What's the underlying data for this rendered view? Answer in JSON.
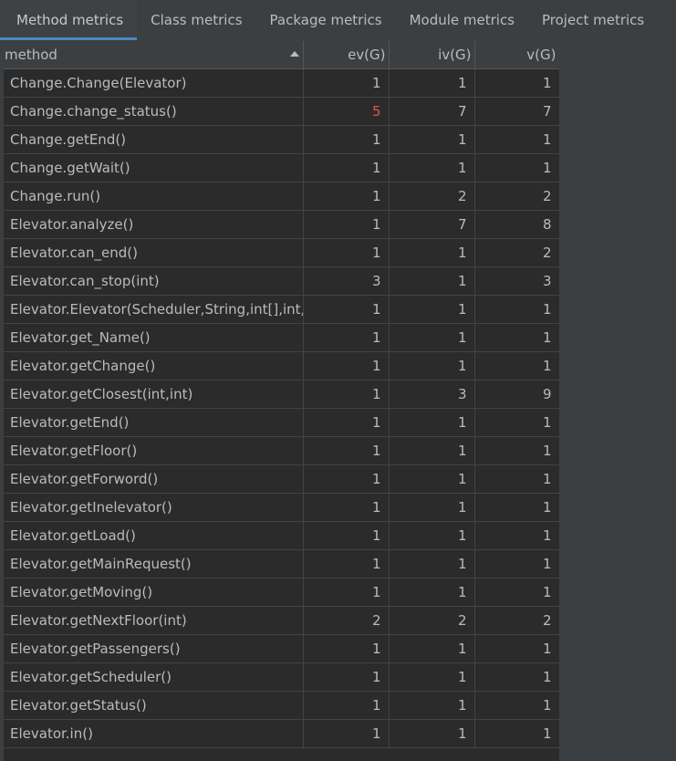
{
  "tabs": [
    {
      "label": "Method metrics",
      "active": true
    },
    {
      "label": "Class metrics",
      "active": false
    },
    {
      "label": "Package metrics",
      "active": false
    },
    {
      "label": "Module metrics",
      "active": false
    },
    {
      "label": "Project metrics",
      "active": false
    }
  ],
  "table": {
    "headers": [
      "method",
      "ev(G)",
      "iv(G)",
      "v(G)"
    ],
    "sorted_column": "method",
    "sort_direction": "ascending",
    "highlight_color": "#e05555",
    "rows": [
      {
        "method": "Change.Change(Elevator)",
        "ev": "1",
        "iv": "1",
        "v": "1"
      },
      {
        "method": "Change.change_status()",
        "ev": "5",
        "iv": "7",
        "v": "7",
        "ev_warn": true
      },
      {
        "method": "Change.getEnd()",
        "ev": "1",
        "iv": "1",
        "v": "1"
      },
      {
        "method": "Change.getWait()",
        "ev": "1",
        "iv": "1",
        "v": "1"
      },
      {
        "method": "Change.run()",
        "ev": "1",
        "iv": "2",
        "v": "2"
      },
      {
        "method": "Elevator.analyze()",
        "ev": "1",
        "iv": "7",
        "v": "8"
      },
      {
        "method": "Elevator.can_end()",
        "ev": "1",
        "iv": "1",
        "v": "2"
      },
      {
        "method": "Elevator.can_stop(int)",
        "ev": "3",
        "iv": "1",
        "v": "3"
      },
      {
        "method": "Elevator.Elevator(Scheduler,String,int[],int,in",
        "ev": "1",
        "iv": "1",
        "v": "1"
      },
      {
        "method": "Elevator.get_Name()",
        "ev": "1",
        "iv": "1",
        "v": "1"
      },
      {
        "method": "Elevator.getChange()",
        "ev": "1",
        "iv": "1",
        "v": "1"
      },
      {
        "method": "Elevator.getClosest(int,int)",
        "ev": "1",
        "iv": "3",
        "v": "9"
      },
      {
        "method": "Elevator.getEnd()",
        "ev": "1",
        "iv": "1",
        "v": "1"
      },
      {
        "method": "Elevator.getFloor()",
        "ev": "1",
        "iv": "1",
        "v": "1"
      },
      {
        "method": "Elevator.getForword()",
        "ev": "1",
        "iv": "1",
        "v": "1"
      },
      {
        "method": "Elevator.getInelevator()",
        "ev": "1",
        "iv": "1",
        "v": "1"
      },
      {
        "method": "Elevator.getLoad()",
        "ev": "1",
        "iv": "1",
        "v": "1"
      },
      {
        "method": "Elevator.getMainRequest()",
        "ev": "1",
        "iv": "1",
        "v": "1"
      },
      {
        "method": "Elevator.getMoving()",
        "ev": "1",
        "iv": "1",
        "v": "1"
      },
      {
        "method": "Elevator.getNextFloor(int)",
        "ev": "2",
        "iv": "2",
        "v": "2"
      },
      {
        "method": "Elevator.getPassengers()",
        "ev": "1",
        "iv": "1",
        "v": "1"
      },
      {
        "method": "Elevator.getScheduler()",
        "ev": "1",
        "iv": "1",
        "v": "1"
      },
      {
        "method": "Elevator.getStatus()",
        "ev": "1",
        "iv": "1",
        "v": "1"
      },
      {
        "method": "Elevator.in()",
        "ev": "1",
        "iv": "1",
        "v": "1"
      }
    ]
  }
}
